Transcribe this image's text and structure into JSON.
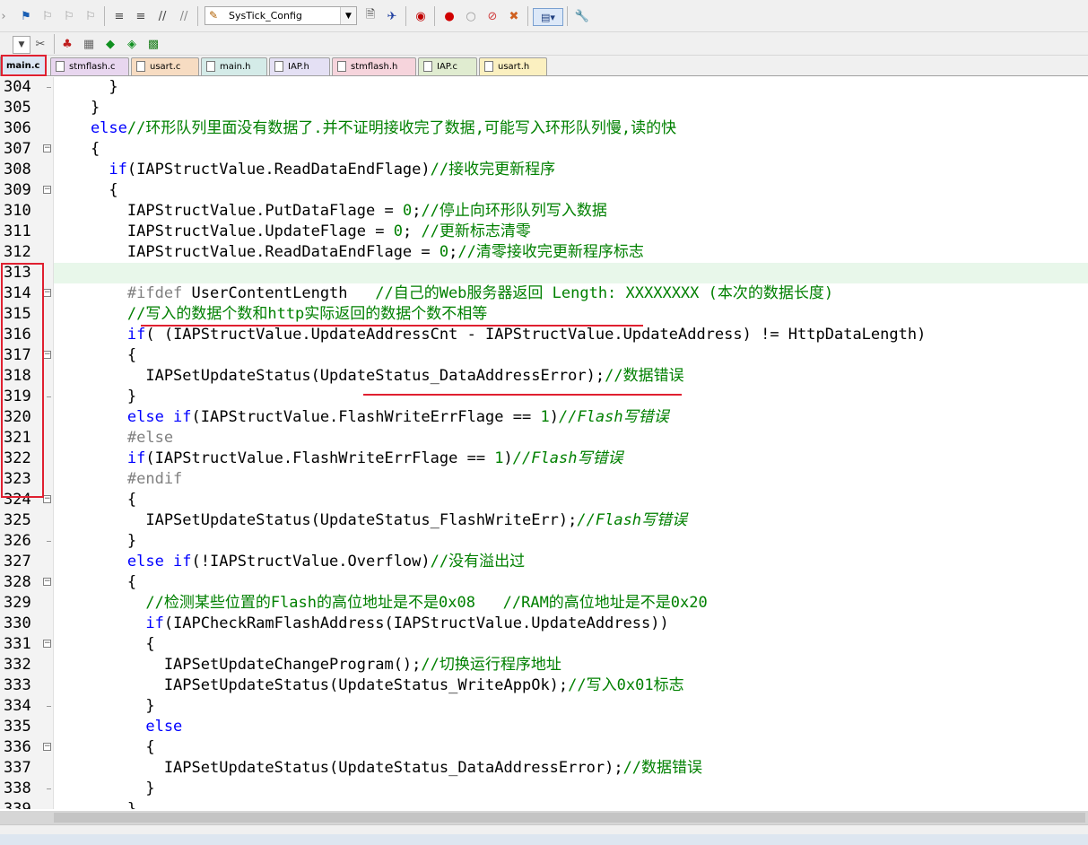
{
  "toolbar": {
    "target_combo": "SysTick_Config",
    "icons_row1": [
      "bookmark-toggle-icon",
      "bookmark-prev-icon",
      "bookmark-next-icon",
      "bookmark-clear-icon",
      "indent-icon",
      "outdent-icon",
      "comment-icon",
      "uncomment-icon",
      "find-in-files-icon",
      "incremental-find-icon",
      "debug-start-icon",
      "breakpoint-insert-icon",
      "breakpoint-enable-icon",
      "breakpoint-disable-icon",
      "breakpoint-kill-icon",
      "window-layout-icon",
      "configure-icon"
    ],
    "icons_row2": [
      "target-options-icon",
      "translate-icon",
      "build-icon",
      "rebuild-icon",
      "download-icon",
      "manage-components-icon"
    ]
  },
  "tabs": [
    {
      "label": "main.c",
      "active": true,
      "color": "#dce6f4"
    },
    {
      "label": "stmflash.c",
      "active": false,
      "color": "#e8d6ef"
    },
    {
      "label": "usart.c",
      "active": false,
      "color": "#f7dcc2"
    },
    {
      "label": "main.h",
      "active": false,
      "color": "#d4ebe8"
    },
    {
      "label": "IAP.h",
      "active": false,
      "color": "#e4e0f4"
    },
    {
      "label": "stmflash.h",
      "active": false,
      "color": "#f6d4dc"
    },
    {
      "label": "IAP.c",
      "active": false,
      "color": "#e0ecd0"
    },
    {
      "label": "usart.h",
      "active": false,
      "color": "#fbf0c0"
    }
  ],
  "colors": {
    "keyword": "#0000ff",
    "comment": "#008000",
    "preprocessor": "#808080",
    "annotation_red": "#e02030",
    "current_line": "#e8f7ea"
  },
  "editor": {
    "lines": [
      {
        "n": "304",
        "fold": "tick",
        "t": [
          [
            "",
            "      }"
          ]
        ]
      },
      {
        "n": "305",
        "fold": "",
        "t": [
          [
            "",
            "    }"
          ]
        ]
      },
      {
        "n": "306",
        "fold": "",
        "t": [
          [
            "kw",
            "    else"
          ],
          [
            "cm",
            "//环形队列里面没有数据了.并不证明接收完了数据,可能写入环形队列慢,读的快"
          ]
        ]
      },
      {
        "n": "307",
        "fold": "box",
        "t": [
          [
            "",
            "    {"
          ]
        ]
      },
      {
        "n": "308",
        "fold": "",
        "t": [
          [
            "kw",
            "      if"
          ],
          [
            "",
            "(IAPStructValue.ReadDataEndFlage)"
          ],
          [
            "cm",
            "//接收完更新程序"
          ]
        ]
      },
      {
        "n": "309",
        "fold": "box",
        "t": [
          [
            "",
            "      {"
          ]
        ]
      },
      {
        "n": "310",
        "fold": "",
        "t": [
          [
            "",
            "        IAPStructValue.PutDataFlage = "
          ],
          [
            "num",
            "0"
          ],
          [
            "",
            ";"
          ],
          [
            "cm",
            "//停止向环形队列写入数据"
          ]
        ]
      },
      {
        "n": "311",
        "fold": "",
        "t": [
          [
            "",
            "        IAPStructValue.UpdateFlage = "
          ],
          [
            "num",
            "0"
          ],
          [
            "",
            "; "
          ],
          [
            "cm",
            "//更新标志清零"
          ]
        ]
      },
      {
        "n": "312",
        "fold": "",
        "t": [
          [
            "",
            "        IAPStructValue.ReadDataEndFlage = "
          ],
          [
            "num",
            "0"
          ],
          [
            "",
            ";"
          ],
          [
            "cm",
            "//清零接收完更新程序标志"
          ]
        ]
      },
      {
        "n": "313",
        "fold": "",
        "hl": true,
        "t": [
          [
            "",
            ""
          ]
        ]
      },
      {
        "n": "314",
        "fold": "box",
        "t": [
          [
            "pp",
            "        #ifdef"
          ],
          [
            "",
            " UserContentLength   "
          ],
          [
            "cm",
            "//自己的Web服务器返回 Length: XXXXXXXX (本次的数据长度)"
          ]
        ]
      },
      {
        "n": "315",
        "fold": "",
        "t": [
          [
            "cm",
            "        //写入的数据个数和http实际返回的数据个数不相等"
          ]
        ]
      },
      {
        "n": "316",
        "fold": "",
        "t": [
          [
            "kw",
            "        if"
          ],
          [
            "",
            "( (IAPStructValue.UpdateAddressCnt - IAPStructValue.UpdateAddress) != HttpDataLength)"
          ]
        ]
      },
      {
        "n": "317",
        "fold": "box",
        "t": [
          [
            "",
            "        {"
          ]
        ]
      },
      {
        "n": "318",
        "fold": "",
        "t": [
          [
            "",
            "          IAPSetUpdateStatus(UpdateStatus_DataAddressError);"
          ],
          [
            "cm",
            "//数据错误"
          ]
        ]
      },
      {
        "n": "319",
        "fold": "tick",
        "t": [
          [
            "",
            "        }"
          ]
        ]
      },
      {
        "n": "320",
        "fold": "",
        "t": [
          [
            "kw",
            "        else if"
          ],
          [
            "",
            "(IAPStructValue.FlashWriteErrFlage == "
          ],
          [
            "num",
            "1"
          ],
          [
            "",
            ")"
          ],
          [
            "cmi",
            "//Flash写错误"
          ]
        ]
      },
      {
        "n": "321",
        "fold": "",
        "t": [
          [
            "pp",
            "        #else"
          ]
        ]
      },
      {
        "n": "322",
        "fold": "",
        "t": [
          [
            "kw",
            "        if"
          ],
          [
            "",
            "(IAPStructValue.FlashWriteErrFlage == "
          ],
          [
            "num",
            "1"
          ],
          [
            "",
            ")"
          ],
          [
            "cmi",
            "//Flash写错误"
          ]
        ]
      },
      {
        "n": "323",
        "fold": "",
        "t": [
          [
            "pp",
            "        #endif"
          ]
        ]
      },
      {
        "n": "324",
        "fold": "box",
        "t": [
          [
            "",
            "        {"
          ]
        ]
      },
      {
        "n": "325",
        "fold": "",
        "t": [
          [
            "",
            "          IAPSetUpdateStatus(UpdateStatus_FlashWriteErr);"
          ],
          [
            "cmi",
            "//Flash写错误"
          ]
        ]
      },
      {
        "n": "326",
        "fold": "tick",
        "t": [
          [
            "",
            "        }"
          ]
        ]
      },
      {
        "n": "327",
        "fold": "",
        "t": [
          [
            "kw",
            "        else if"
          ],
          [
            "",
            "(!IAPStructValue.Overflow)"
          ],
          [
            "cm",
            "//没有溢出过"
          ]
        ]
      },
      {
        "n": "328",
        "fold": "box",
        "t": [
          [
            "",
            "        {"
          ]
        ]
      },
      {
        "n": "329",
        "fold": "",
        "t": [
          [
            "cm",
            "          //检测某些位置的Flash的高位地址是不是0x08   //RAM的高位地址是不是0x20"
          ]
        ]
      },
      {
        "n": "330",
        "fold": "",
        "t": [
          [
            "kw",
            "          if"
          ],
          [
            "",
            "(IAPCheckRamFlashAddress(IAPStructValue.UpdateAddress))"
          ]
        ]
      },
      {
        "n": "331",
        "fold": "box",
        "t": [
          [
            "",
            "          {"
          ]
        ]
      },
      {
        "n": "332",
        "fold": "",
        "t": [
          [
            "",
            "            IAPSetUpdateChangeProgram();"
          ],
          [
            "cm",
            "//切换运行程序地址"
          ]
        ]
      },
      {
        "n": "333",
        "fold": "",
        "t": [
          [
            "",
            "            IAPSetUpdateStatus(UpdateStatus_WriteAppOk);"
          ],
          [
            "cm",
            "//写入0x01标志"
          ]
        ]
      },
      {
        "n": "334",
        "fold": "tick",
        "t": [
          [
            "",
            "          }"
          ]
        ]
      },
      {
        "n": "335",
        "fold": "",
        "t": [
          [
            "kw",
            "          else"
          ]
        ]
      },
      {
        "n": "336",
        "fold": "box",
        "t": [
          [
            "",
            "          {"
          ]
        ]
      },
      {
        "n": "337",
        "fold": "",
        "t": [
          [
            "",
            "            IAPSetUpdateStatus(UpdateStatus_DataAddressError);"
          ],
          [
            "cm",
            "//数据错误"
          ]
        ]
      },
      {
        "n": "338",
        "fold": "tick",
        "t": [
          [
            "",
            "          }"
          ]
        ]
      },
      {
        "n": "339",
        "fold": "",
        "t": [
          [
            "",
            "        }"
          ]
        ]
      }
    ]
  }
}
